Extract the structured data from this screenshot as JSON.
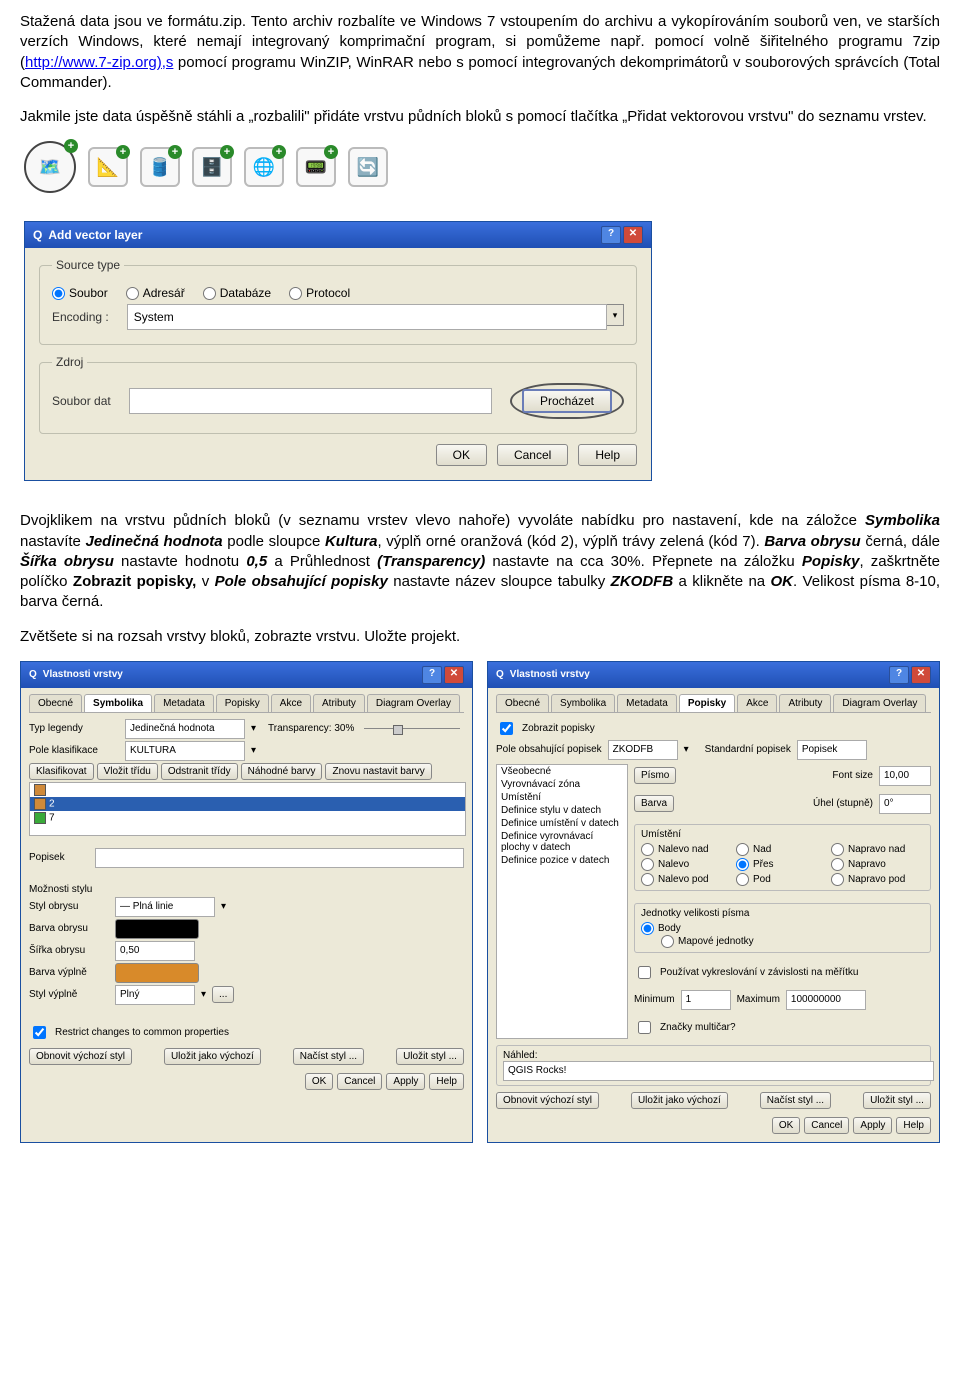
{
  "para1_prefix": "Stažená data jsou ve formátu.zip. Tento archiv rozbalíte ve Windows 7  vstoupením do archivu a vykopírováním souborů ven, ve starších verzích Windows, které nemají integrovaný komprimační program, si pomůžeme např. pomocí volně šiřitelného programu 7zip (",
  "para1_link": "http://www.7-zip.org),s",
  "para1_suffix": " pomocí programu WinZIP, WinRAR nebo s pomocí integrovaných dekomprimátorů v souborových správcích (Total Commander).",
  "para2": "Jakmile jste data úspěšně stáhli a „rozbalili\" přidáte vrstvu půdních bloků s pomocí tlačítka „Přidat vektorovou vrstvu\" do seznamu vrstev.",
  "toolbar": {
    "icons": [
      "map-layer",
      "polygon",
      "database",
      "cans",
      "globe",
      "gps",
      "refresh"
    ]
  },
  "dlg1": {
    "title": "Add vector layer",
    "grp_source": "Source type",
    "r_soubor": "Soubor",
    "r_adresar": "Adresář",
    "r_db": "Databáze",
    "r_proto": "Protocol",
    "encoding_lbl": "Encoding :",
    "encoding_val": "System",
    "grp_zdroj": "Zdroj",
    "soubor_dat": "Soubor dat",
    "browse": "Procházet",
    "ok": "OK",
    "cancel": "Cancel",
    "help": "Help"
  },
  "para3_a": "Dvojklikem na vrstvu půdních bloků (v seznamu vrstev vlevo nahoře) vyvoláte nabídku pro nastavení, kde na záložce ",
  "para3_sym": "Symbolika",
  "para3_b": " nastavíte ",
  "para3_jed": "Jedinečná hodnota",
  "para3_c": " podle sloupce ",
  "para3_kult": "Kultura",
  "para3_d": ", výplň orné oranžová (kód 2), výplň trávy zelená (kód 7). ",
  "para3_barva": "Barva obrysu",
  "para3_e": " černá, dále ",
  "para3_sirka": "Šířka obrysu",
  "para3_f": " nastavte hodnotu ",
  "para3_05": "0,5",
  "para3_g": " a Průhlednost ",
  "para3_trans": "(Transparency)",
  "para3_h": " nastavte na cca 30%. Přepnete na záložku ",
  "para3_pop": "Popisky",
  "para3_i": ", zaškrtněte políčko ",
  "para3_zobr": "Zobrazit popisky,",
  "para3_j": "  v ",
  "para3_pole": "Pole obsahující popisky",
  "para3_k": " nastavte název sloupce tabulky ",
  "para3_zkod": "ZKODFB",
  "para3_l": " a klikněte na ",
  "para3_ok": "OK",
  "para3_m": ". Velikost písma 8-10, barva černá.",
  "para4": "Zvětšete si na rozsah vrstvy bloků, zobrazte vrstvu. Uložte projekt.",
  "dlg2": {
    "title": "Vlastnosti vrstvy",
    "tabs": [
      "Obecné",
      "Symbolika",
      "Metadata",
      "Popisky",
      "Akce",
      "Atributy",
      "Diagram Overlay"
    ],
    "typ_leg": "Typ legendy",
    "jed": "Jedinečná hodnota",
    "trans": "Transparency: 30%",
    "pole_klas": "Pole klasifikace",
    "kultura": "KULTURA",
    "btns": [
      "Klasifikovat",
      "Vložit třídu",
      "Odstranit třídy",
      "Náhodné barvy",
      "Znovu nastavit barvy"
    ],
    "list_items": [
      "2",
      "7"
    ],
    "popisek": "Popisek",
    "moznosti": "Možnosti stylu",
    "styl_obrysu": "Styl obrysu",
    "plna": "— Plná linie",
    "barva_obrysu": "Barva obrysu",
    "sirka_obrysu": "Šířka obrysu",
    "sirka_val": "0,50",
    "barva_vyplne": "Barva výplně",
    "styl_vyplne": "Styl výplně",
    "plny": "Plný",
    "restrict": "Restrict changes to common properties",
    "footer": [
      "Obnovit výchozí styl",
      "Uložit jako výchozí",
      "Načíst styl ...",
      "Uložit styl ..."
    ],
    "bottom": [
      "OK",
      "Cancel",
      "Apply",
      "Help"
    ]
  },
  "dlg3": {
    "title": "Vlastnosti vrstvy",
    "tabs": [
      "Obecné",
      "Symbolika",
      "Metadata",
      "Popisky",
      "Akce",
      "Atributy",
      "Diagram Overlay"
    ],
    "zobr": "Zobrazit popisky",
    "pole_lbl": "Pole obsahující popisek",
    "pole_val": "ZKODFB",
    "std_lbl": "Standardní popisek",
    "std_val": "Popisek",
    "side": [
      "Všeobecné",
      "Vyrovnávací zóna",
      "Umístění",
      "Definice stylu v datech",
      "Definice umístění v datech",
      "Definice vyrovnávací plochy v datech",
      "Definice pozice v datech"
    ],
    "pismo": "Písmo",
    "fontsize": "Font size",
    "fs_val": "10,00",
    "barva": "Barva",
    "uhel": "Úhel (stupně)",
    "uhel_val": "0°",
    "umisteni": "Umístění",
    "pos": [
      "Nalevo nad",
      "Nad",
      "Napravo nad",
      "Nalevo",
      "Přes",
      "Napravo",
      "Nalevo pod",
      "Pod",
      "Napravo pod"
    ],
    "jednotky": "Jednotky velikosti písma",
    "body": "Body",
    "mapove": "Mapové jednotky",
    "pouzit": "Používat vykreslování v závislosti na měřítku",
    "min": "Minimum",
    "min_val": "1",
    "max": "Maximum",
    "max_val": "100000000",
    "znacky": "Značky multičar?",
    "nahled": "Náhled:",
    "rocks": "QGIS Rocks!",
    "footer": [
      "Obnovit výchozí styl",
      "Uložit jako výchozí",
      "Načíst styl ...",
      "Uložit styl ..."
    ],
    "bottom": [
      "OK",
      "Cancel",
      "Apply",
      "Help"
    ]
  }
}
